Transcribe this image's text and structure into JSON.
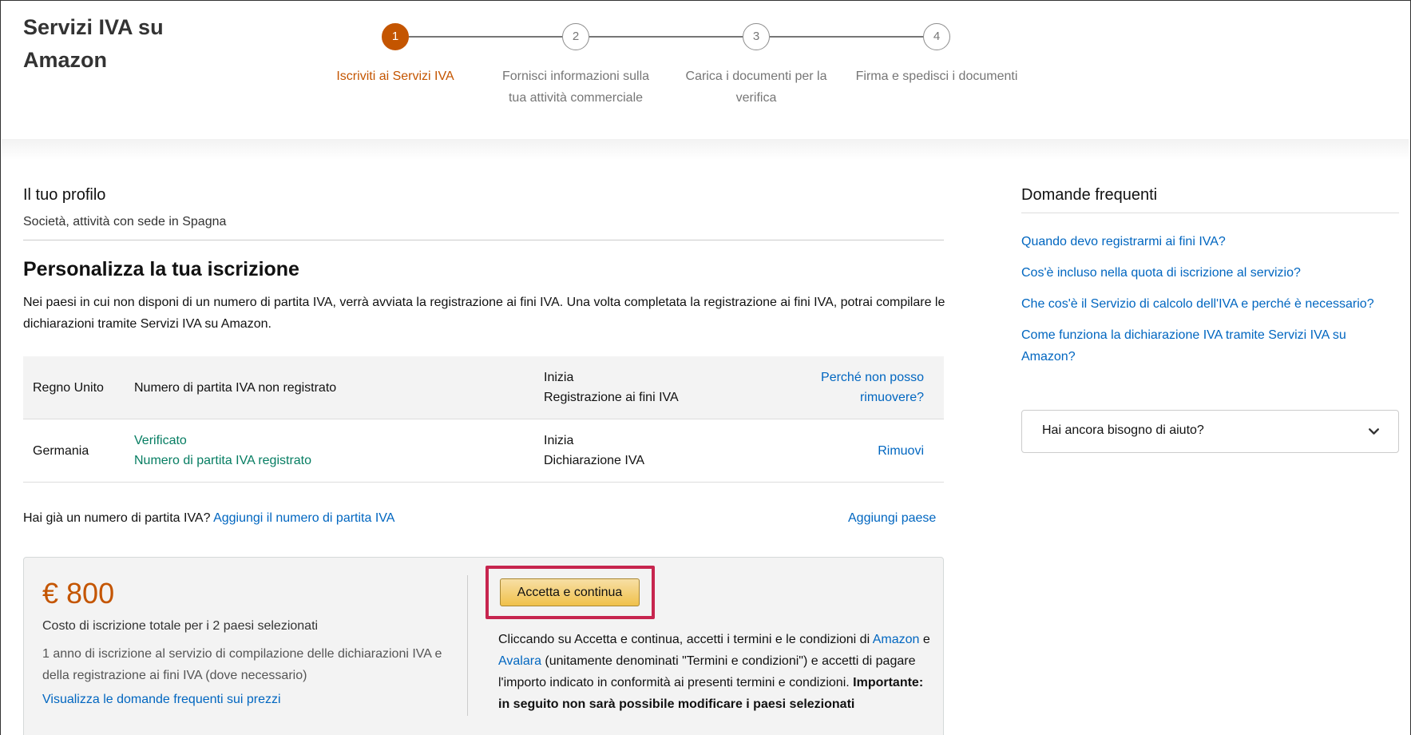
{
  "header": {
    "title": "Servizi IVA su Amazon"
  },
  "stepper": {
    "steps": [
      {
        "number": "1",
        "label": "Iscriviti ai Servizi IVA"
      },
      {
        "number": "2",
        "label": "Fornisci informazioni sulla tua attività commerciale"
      },
      {
        "number": "3",
        "label": "Carica i documenti per la verifica"
      },
      {
        "number": "4",
        "label": "Firma e spedisci i documenti"
      }
    ]
  },
  "profile": {
    "heading": "Il tuo profilo",
    "subtitle": "Società, attività con sede in Spagna"
  },
  "customize": {
    "title": "Personalizza la tua iscrizione",
    "description": "Nei paesi in cui non disponi di un numero di partita IVA, verrà avviata la registrazione ai fini IVA. Una volta completata la registrazione ai fini IVA, potrai compilare le dichiarazioni tramite Servizi IVA su Amazon."
  },
  "countries": [
    {
      "country": "Regno Unito",
      "status_label": "",
      "status": "Numero di partita IVA non registrato",
      "action_line1": "Inizia",
      "action_line2": "Registrazione ai fini IVA",
      "link": "Perché non posso rimuovere?"
    },
    {
      "country": "Germania",
      "status_label": "Verificato",
      "status": "Numero di partita IVA registrato",
      "action_line1": "Inizia",
      "action_line2": "Dichiarazione IVA",
      "link": "Rimuovi"
    }
  ],
  "add_vat": {
    "question": "Hai già un numero di partita IVA?",
    "link": "Aggiungi il numero di partita IVA",
    "add_country": "Aggiungi paese"
  },
  "pricing": {
    "amount": "€ 800",
    "total_label": "Costo di iscrizione totale per i 2 paesi selezionati",
    "description": "1 anno di iscrizione al servizio di compilazione delle dichiarazioni IVA e della registrazione ai fini IVA (dove necessario)",
    "faq_link": "Visualizza le domande frequenti sui prezzi",
    "cta_label": "Accetta e continua",
    "terms_part1": "Cliccando su Accetta e continua, accetti i termini e le condizioni di",
    "terms_amazon": "Amazon",
    "terms_and": "e",
    "terms_avalara": "Avalara",
    "terms_part2": "(unitamente denominati \"Termini e condizioni\") e accetti di pagare l'importo indicato in conformità ai presenti termini e condizioni.",
    "terms_important": "Importante: in seguito non sarà possibile modificare i paesi selezionati"
  },
  "faq": {
    "title": "Domande frequenti",
    "links": [
      "Quando devo registrarmi ai fini IVA?",
      "Cos'è incluso nella quota di iscrizione al servizio?",
      "Che cos'è il Servizio di calcolo dell'IVA e perché è necessario?",
      "Come funziona la dichiarazione IVA tramite Servizi IVA su Amazon?"
    ],
    "help_label": "Hai ancora bisogno di aiuto?"
  },
  "colors": {
    "accent": "#c45500",
    "link": "#0066c0",
    "verified": "#067d62",
    "highlight": "#c7254e"
  }
}
